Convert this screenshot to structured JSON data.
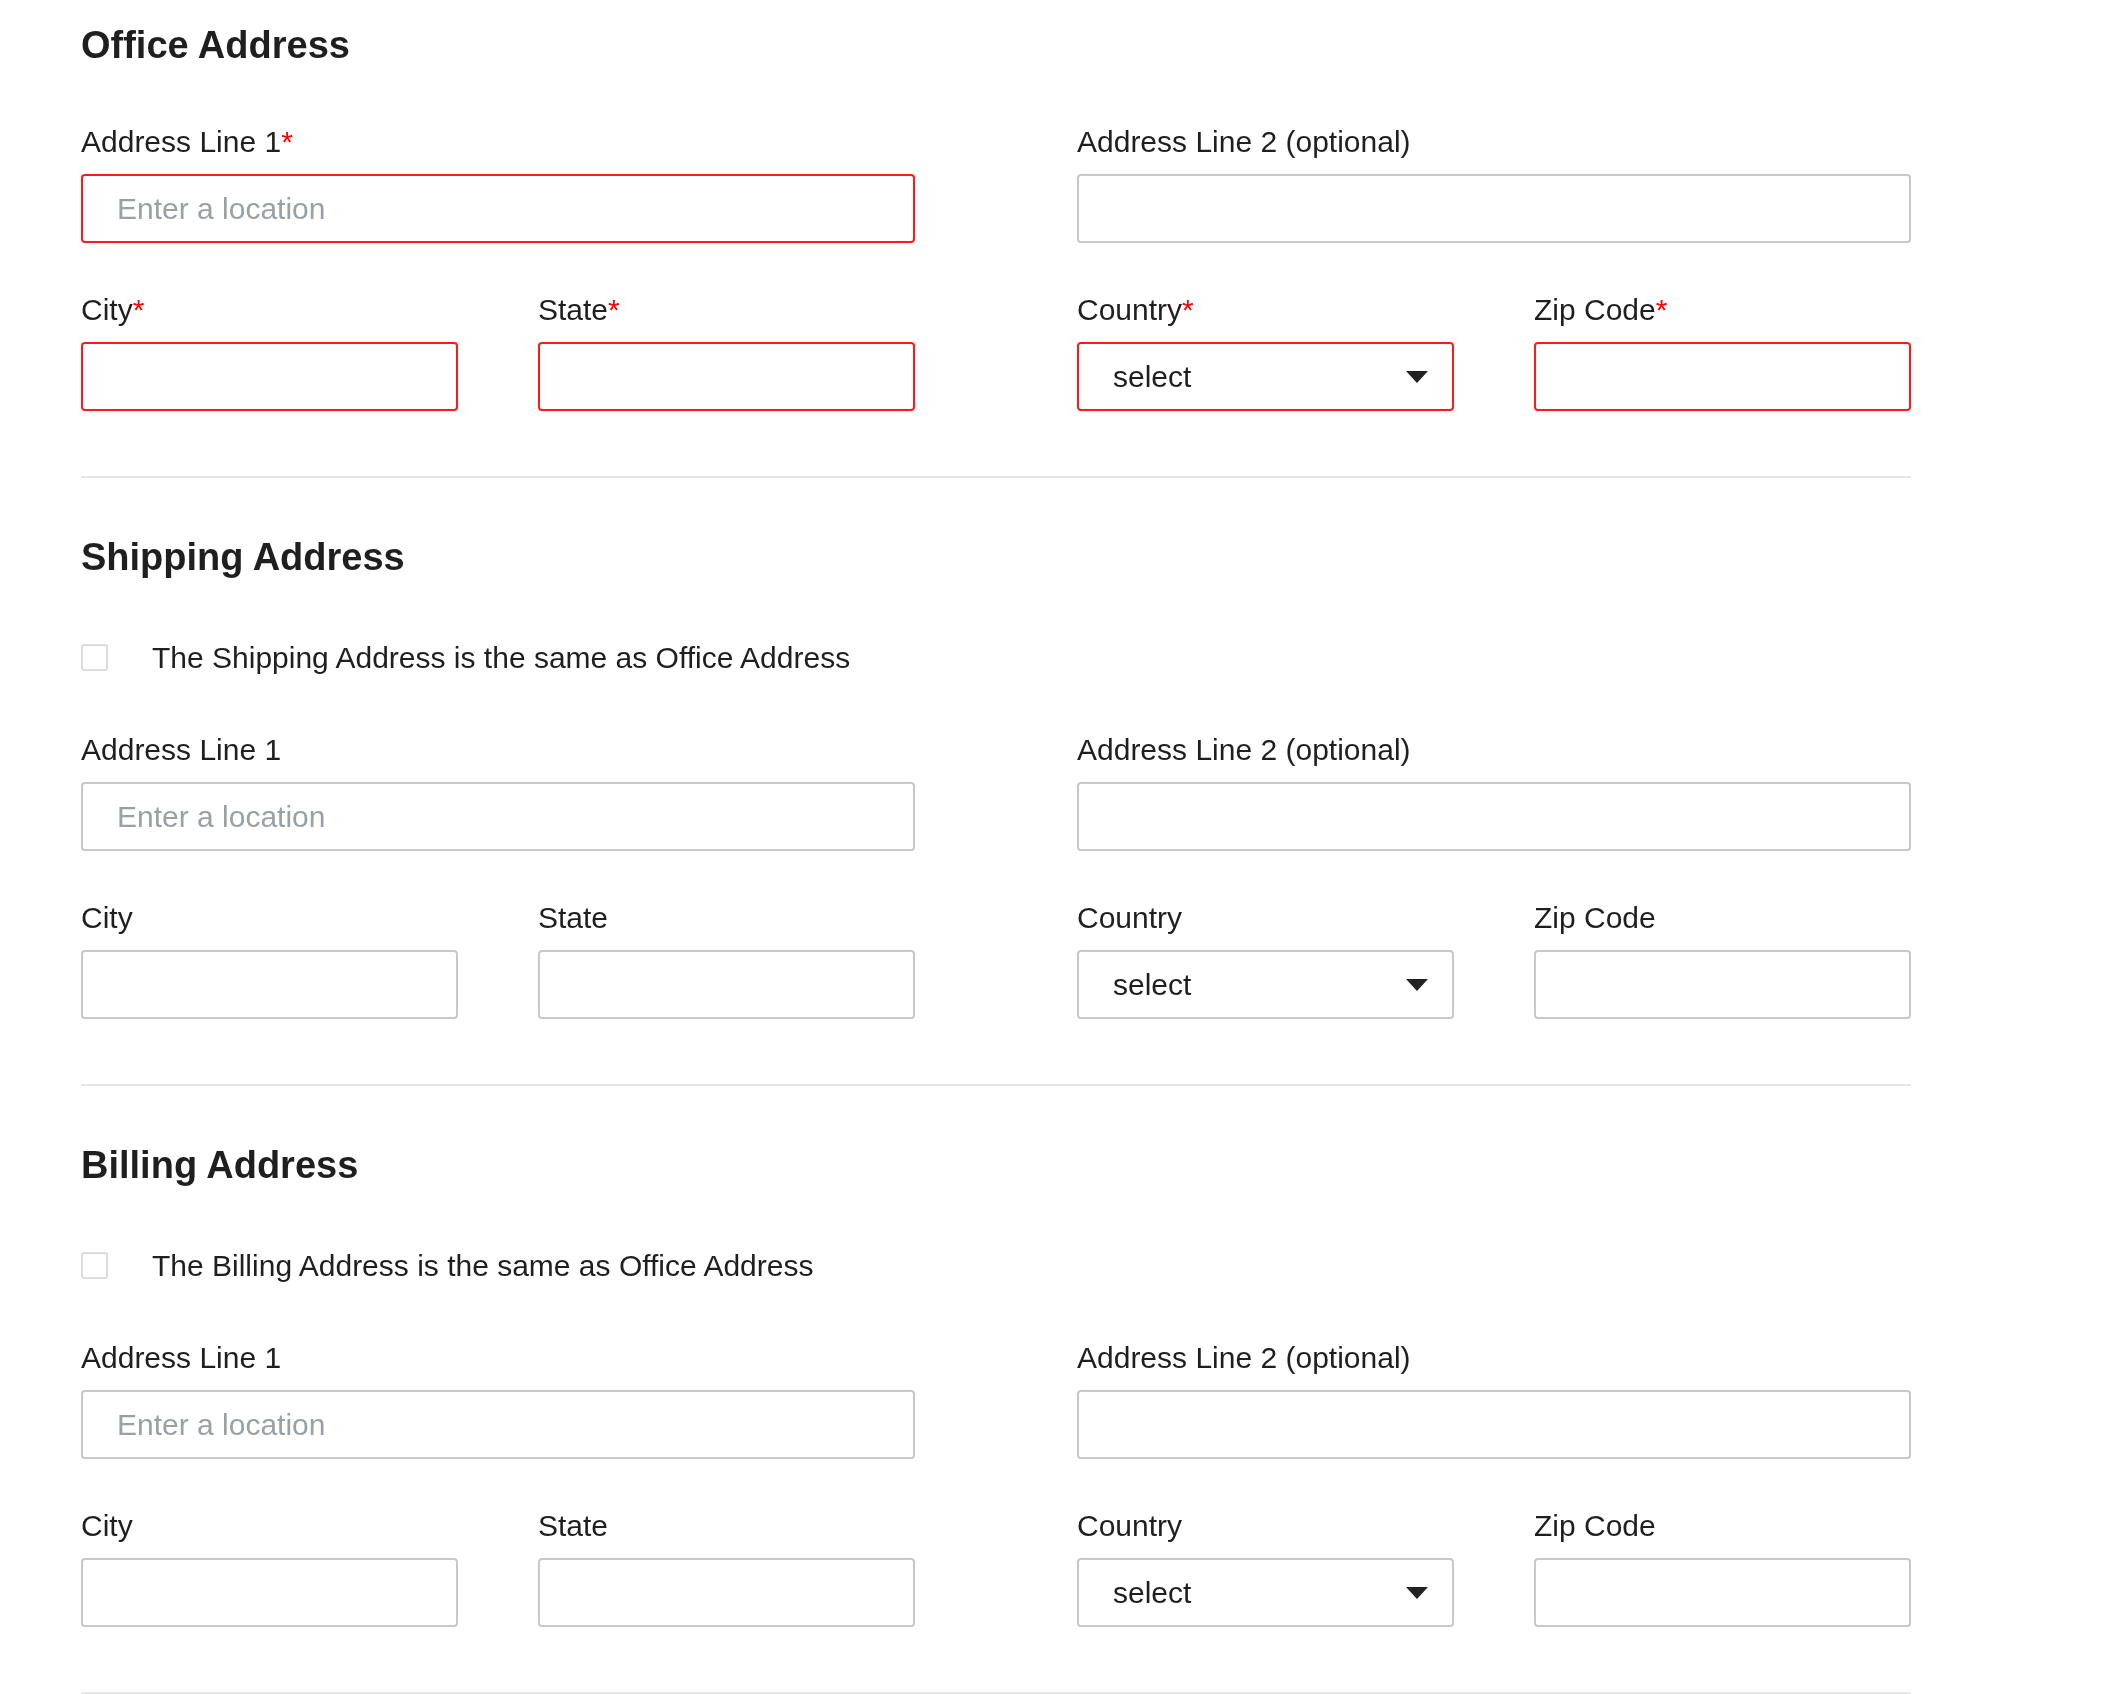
{
  "sections": [
    {
      "title": "Office Address",
      "fields": [
        {
          "label": "Address Line 1",
          "required_mark": "*",
          "required": true,
          "kind": "wide",
          "placeholder": "Enter a location"
        },
        {
          "label": "Address Line 2 (optional)",
          "required": false,
          "kind": "wide"
        },
        {
          "label": "City",
          "required_mark": "*",
          "required": true,
          "kind": "text"
        },
        {
          "label": "State",
          "required_mark": "*",
          "required": true,
          "kind": "text"
        },
        {
          "label": "Country",
          "required_mark": "*",
          "required": true,
          "kind": "select",
          "value": "select"
        },
        {
          "label": "Zip Code",
          "required_mark": "*",
          "required": true,
          "kind": "text"
        }
      ]
    },
    {
      "title": "Shipping Address",
      "same_as": {
        "label": "The Shipping Address is the same as Office Address",
        "checked": false
      },
      "fields": [
        {
          "label": "Address Line 1",
          "required": false,
          "kind": "wide",
          "placeholder": "Enter a location"
        },
        {
          "label": "Address Line 2 (optional)",
          "required": false,
          "kind": "wide"
        },
        {
          "label": "City",
          "required": false,
          "kind": "text"
        },
        {
          "label": "State",
          "required": false,
          "kind": "text"
        },
        {
          "label": "Country",
          "required": false,
          "kind": "select",
          "value": "select"
        },
        {
          "label": "Zip Code",
          "required": false,
          "kind": "text"
        }
      ]
    },
    {
      "title": "Billing Address",
      "same_as": {
        "label": "The Billing Address is the same as Office Address",
        "checked": false
      },
      "fields": [
        {
          "label": "Address Line 1",
          "required": false,
          "kind": "wide",
          "placeholder": "Enter a location"
        },
        {
          "label": "Address Line 2 (optional)",
          "required": false,
          "kind": "wide"
        },
        {
          "label": "City",
          "required": false,
          "kind": "text"
        },
        {
          "label": "State",
          "required": false,
          "kind": "text"
        },
        {
          "label": "Country",
          "required": false,
          "kind": "select",
          "value": "select"
        },
        {
          "label": "Zip Code",
          "required": false,
          "kind": "text"
        }
      ]
    }
  ]
}
